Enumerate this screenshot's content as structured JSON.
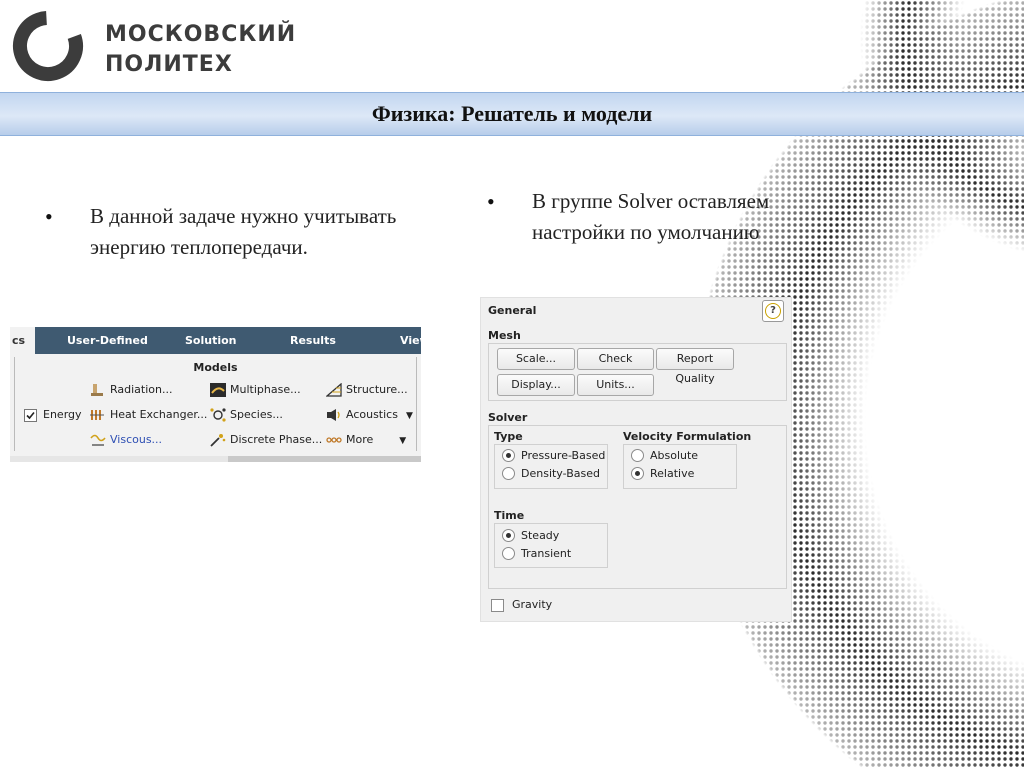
{
  "logo": {
    "line1": "МОСКОВСКИЙ",
    "line2": "ПОЛИТЕХ"
  },
  "slide_title": "Физика: Решатель и модели",
  "bullets": {
    "left": {
      "line1": "В данной задаче нужно учитывать",
      "line2": "энергию теплопередачи."
    },
    "right": {
      "line1": "В группе Solver оставляем",
      "line2": "настройки по умолчанию"
    }
  },
  "ribbon": {
    "tabs": [
      "cs",
      "User-Defined",
      "Solution",
      "Results",
      "View"
    ],
    "group_title": "Models",
    "energy": {
      "label": "Energy",
      "checked": true
    },
    "items": {
      "radiation": "Radiation...",
      "heat_exchanger": "Heat Exchanger...",
      "viscous": "Viscous...",
      "multiphase": "Multiphase...",
      "species": "Species...",
      "discrete_phase": "Discrete Phase...",
      "structure": "Structure...",
      "acoustics": "Acoustics",
      "more": "More"
    },
    "icons": {
      "radiation": "radiation-icon",
      "heat_exchanger": "heat-exchanger-icon",
      "viscous": "viscous-icon",
      "multiphase": "multiphase-icon",
      "species": "species-icon",
      "discrete_phase": "discrete-phase-icon",
      "structure": "structure-icon",
      "acoustics": "acoustics-icon",
      "more": "more-icon"
    }
  },
  "general_panel": {
    "title": "General",
    "help_icon": "?",
    "mesh": {
      "label": "Mesh",
      "buttons": {
        "scale": "Scale...",
        "check": "Check",
        "report_quality": "Report Quality",
        "display": "Display...",
        "units": "Units..."
      }
    },
    "solver": {
      "label": "Solver",
      "type": {
        "label": "Type",
        "options": [
          "Pressure-Based",
          "Density-Based"
        ],
        "selected": "Pressure-Based"
      },
      "velocity_formulation": {
        "label": "Velocity Formulation",
        "options": [
          "Absolute",
          "Relative"
        ],
        "selected": "Relative"
      },
      "time": {
        "label": "Time",
        "options": [
          "Steady",
          "Transient"
        ],
        "selected": "Steady"
      }
    },
    "gravity": {
      "label": "Gravity",
      "checked": false
    }
  },
  "colors": {
    "title_bar": "#c9dbf2",
    "ribbon_tabs_bg": "#3f5a71",
    "link_blue": "#2e4fb3",
    "halftone": "#2b2b2b"
  }
}
